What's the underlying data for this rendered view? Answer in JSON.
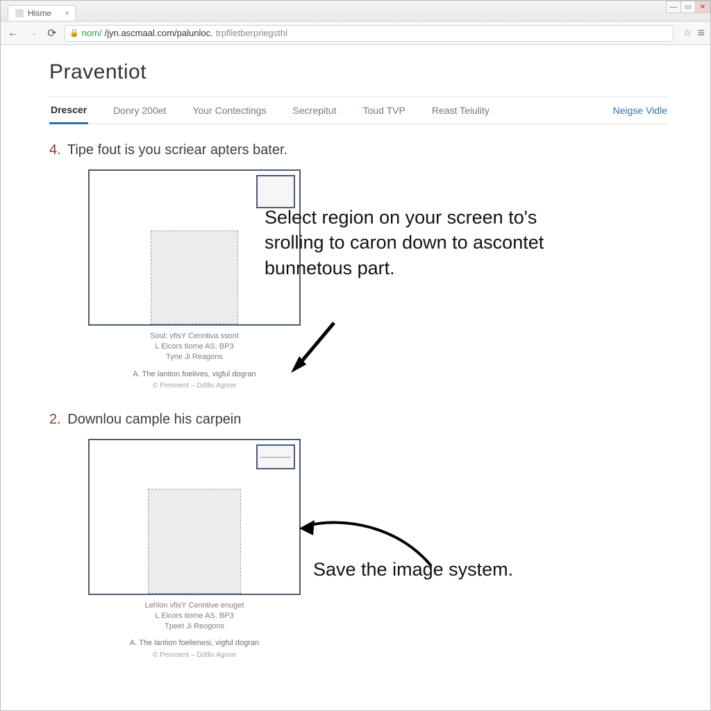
{
  "browser": {
    "tab_title": "Hisme",
    "url_scheme": "nom/",
    "url_host": "/jyn.ascmaal.com/palunloc.",
    "url_path": "trpflletberpriegsthl"
  },
  "page": {
    "brand": "Praventiot",
    "tabs": [
      {
        "label": "Drescer",
        "active": true
      },
      {
        "label": "Donry 200et"
      },
      {
        "label": "Your Contectings"
      },
      {
        "label": "Secrepitut"
      },
      {
        "label": "Toud TVP"
      },
      {
        "label": "Reast Teiulity"
      }
    ],
    "right_link": "Neigse Vidle"
  },
  "steps": [
    {
      "num": "4.",
      "title": "Tipe fout is you scriear apters bater.",
      "caption_lines": [
        "Soul: vfisY Cenntiva ssont",
        "L Eicors tiome AS. BP3",
        "Tyne Ji Reagons"
      ],
      "caption_sub": "A. The lantion foelives, vigful dogran",
      "caption_meta": "© Pensoent – Ddtllo Agone"
    },
    {
      "num": "2.",
      "title": "Downlou cample his carpein",
      "caption_lines": [
        "Lehlon vfisY Cenntive enuget",
        "L Eicors tiome AS. BP3",
        "Tpeet Ji Reogons"
      ],
      "caption_sub": "A. The lantion foelienesi, vigful dogran",
      "caption_meta": "© Pensoent – Ddtllo Agone"
    }
  ],
  "annotations": {
    "a1": "Select region on your screen to's srolling to caron down to ascontet bunnetous part.",
    "a2": "Save the image system."
  }
}
